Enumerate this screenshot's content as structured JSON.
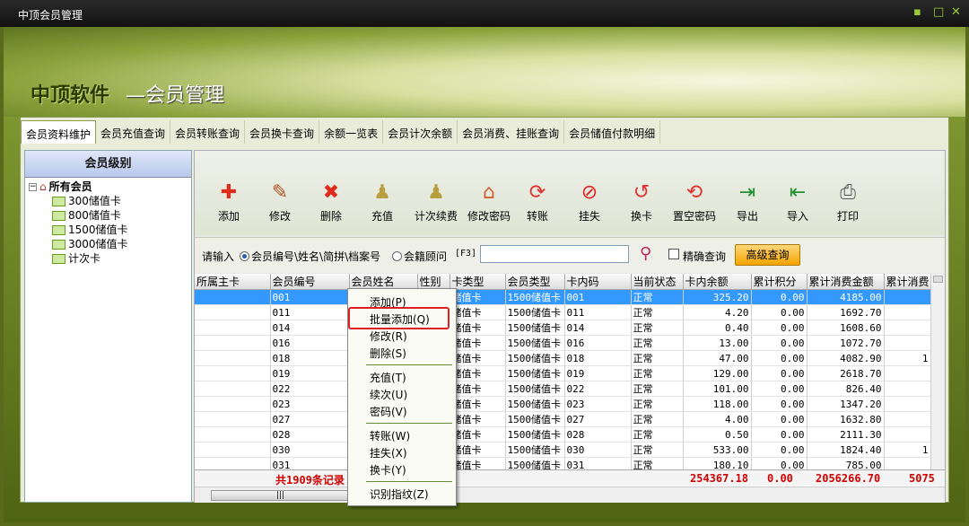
{
  "window": {
    "title": "中顶会员管理"
  },
  "banner": {
    "brand": "中顶软件",
    "subtitle": "—会员管理"
  },
  "tabs": [
    "会员资料维护",
    "会员充值查询",
    "会员转账查询",
    "会员换卡查询",
    "余额一览表",
    "会员计次余额",
    "会员消费、挂账查询",
    "会员储值付款明细"
  ],
  "left": {
    "header": "会员级别",
    "root": "所有会员",
    "children": [
      "300储值卡",
      "800储值卡",
      "1500储值卡",
      "3000储值卡",
      "计次卡"
    ]
  },
  "toolbar": [
    {
      "label": "添加",
      "icon": "add-icon"
    },
    {
      "label": "修改",
      "icon": "edit-icon"
    },
    {
      "label": "删除",
      "icon": "delete-icon"
    },
    {
      "label": "充值",
      "icon": "recharge-icon"
    },
    {
      "label": "计次续费",
      "icon": "renew-icon"
    },
    {
      "label": "修改密码",
      "icon": "password-icon"
    },
    {
      "label": "转账",
      "icon": "transfer-icon"
    },
    {
      "label": "挂失",
      "icon": "report-loss-icon"
    },
    {
      "label": "换卡",
      "icon": "change-card-icon"
    },
    {
      "label": "置空密码",
      "icon": "clear-password-icon"
    },
    {
      "label": "导出",
      "icon": "export-icon"
    },
    {
      "label": "导入",
      "icon": "import-icon"
    },
    {
      "label": "打印",
      "icon": "print-icon"
    }
  ],
  "search": {
    "prompt": "请输入",
    "option1": "会员编号\\姓名\\简拼\\档案号",
    "option2": "会籍顾问",
    "hotkey": "[F3]",
    "exact": "精确查询",
    "advanced": "高级查询"
  },
  "table": {
    "columns": [
      "所属主卡",
      "会员编号",
      "会员姓名",
      "性别",
      "卡类型",
      "会员类型",
      "卡内码",
      "当前状态",
      "卡内余额",
      "累计积分",
      "累计消费金额",
      "累计消费"
    ],
    "rows": [
      [
        "",
        "001",
        "",
        "",
        "储值卡",
        "1500储值卡",
        "001",
        "正常",
        "325.20",
        "0.00",
        "4185.00",
        ""
      ],
      [
        "",
        "011",
        "",
        "",
        "储值卡",
        "1500储值卡",
        "011",
        "正常",
        "4.20",
        "0.00",
        "1692.70",
        ""
      ],
      [
        "",
        "014",
        "",
        "",
        "储值卡",
        "1500储值卡",
        "014",
        "正常",
        "0.40",
        "0.00",
        "1608.60",
        ""
      ],
      [
        "",
        "016",
        "",
        "",
        "储值卡",
        "1500储值卡",
        "016",
        "正常",
        "13.00",
        "0.00",
        "1072.70",
        ""
      ],
      [
        "",
        "018",
        "",
        "",
        "储值卡",
        "1500储值卡",
        "018",
        "正常",
        "47.00",
        "0.00",
        "4082.90",
        "1"
      ],
      [
        "",
        "019",
        "",
        "",
        "储值卡",
        "1500储值卡",
        "019",
        "正常",
        "129.00",
        "0.00",
        "2618.70",
        ""
      ],
      [
        "",
        "022",
        "",
        "",
        "储值卡",
        "1500储值卡",
        "022",
        "正常",
        "101.00",
        "0.00",
        "826.40",
        ""
      ],
      [
        "",
        "023",
        "",
        "",
        "储值卡",
        "1500储值卡",
        "023",
        "正常",
        "118.00",
        "0.00",
        "1347.20",
        ""
      ],
      [
        "",
        "027",
        "",
        "",
        "储值卡",
        "1500储值卡",
        "027",
        "正常",
        "4.00",
        "0.00",
        "1632.80",
        ""
      ],
      [
        "",
        "028",
        "",
        "",
        "储值卡",
        "1500储值卡",
        "028",
        "正常",
        "0.50",
        "0.00",
        "2111.30",
        ""
      ],
      [
        "",
        "030",
        "",
        "",
        "储值卡",
        "1500储值卡",
        "030",
        "正常",
        "533.00",
        "0.00",
        "1824.40",
        "1"
      ],
      [
        "",
        "031",
        "",
        "",
        "储值卡",
        "1500储值卡",
        "031",
        "正常",
        "180.10",
        "0.00",
        "785.00",
        ""
      ]
    ],
    "summary": {
      "count": "共1909条记录",
      "balance": "254367.18",
      "points": "0.00",
      "consume": "2056266.70",
      "consume2": "5075"
    }
  },
  "context_menu": {
    "items": [
      "添加(P)",
      "批量添加(Q)",
      "修改(R)",
      "删除(S)",
      "充值(T)",
      "续次(U)",
      "密码(V)",
      "转账(W)",
      "挂失(X)",
      "换卡(Y)",
      "识别指纹(Z)"
    ]
  }
}
